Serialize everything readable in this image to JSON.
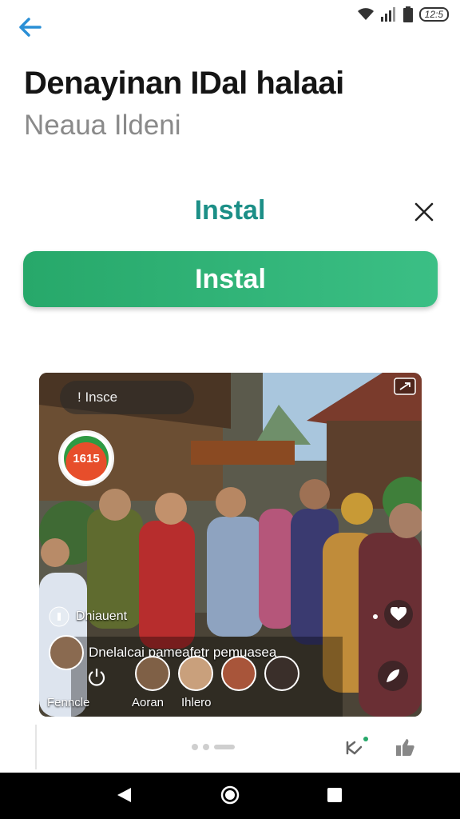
{
  "status": {
    "time_badge": "12:5"
  },
  "header": {
    "title": "Denayinan IDal halaai",
    "subtitle": "Neaua Ildeni"
  },
  "install_section": {
    "heading": "Instal",
    "button_label": "Instal"
  },
  "media": {
    "search_chip": "! Insce",
    "logo_text": "1615",
    "caption_small": "Dhiauent",
    "caption_line": "Dnelalcai pameafetr pemuasea",
    "labels": [
      "Fenncle",
      "Aoran",
      "Ihlero"
    ]
  },
  "colors": {
    "accent": "#1c8f87",
    "button": "#27a86a",
    "back_arrow": "#2a8fd6"
  }
}
